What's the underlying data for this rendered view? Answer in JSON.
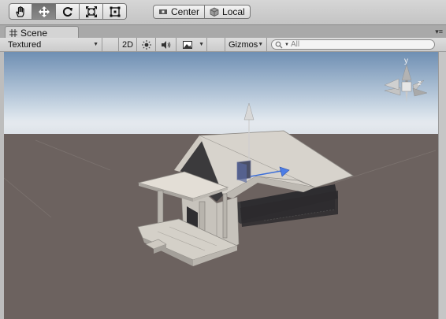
{
  "toolbar": {
    "tools": [
      {
        "name": "hand-tool",
        "icon": "hand-icon"
      },
      {
        "name": "move-tool",
        "icon": "move-icon",
        "active": true
      },
      {
        "name": "rotate-tool",
        "icon": "rotate-icon"
      },
      {
        "name": "scale-tool",
        "icon": "scale-icon"
      },
      {
        "name": "rect-tool",
        "icon": "rect-icon"
      }
    ],
    "pivot_label": "Center",
    "space_label": "Local"
  },
  "tab": {
    "label": "Scene",
    "icon": "grid-icon"
  },
  "scene_toolbar": {
    "draw_mode": "Textured",
    "mode_2d": "2D",
    "gizmos_label": "Gizmos",
    "search_placeholder": "All"
  },
  "orientation_gizmo": {
    "y_label": "y",
    "z_label": "z"
  },
  "colors": {
    "sky_top": "#6f8fb3",
    "horizon": "#e4eaf0",
    "ground": "#6c625f",
    "house": "#d7d3cc",
    "gizmo_blue": "#3d6fd8"
  }
}
